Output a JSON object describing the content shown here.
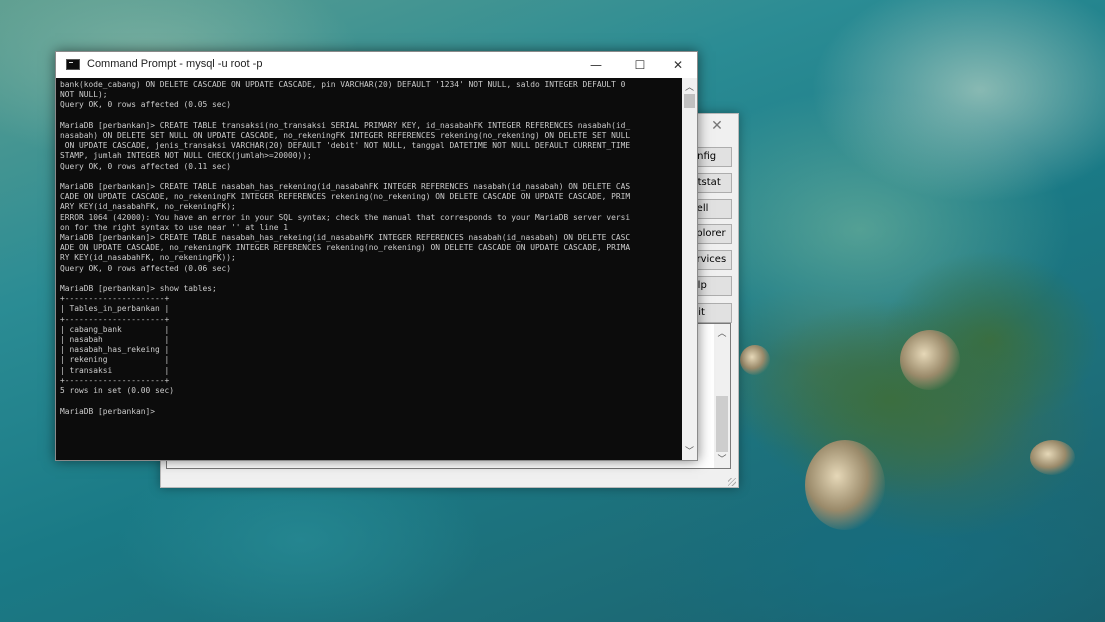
{
  "desktop": {
    "wallpaper": "satellite-coastline"
  },
  "back_window": {
    "close_symbol": "✕",
    "buttons": [
      "Config",
      "Netstat",
      "Shell",
      "Explorer",
      "Services",
      "Help",
      "Quit"
    ]
  },
  "cmd_window": {
    "title": "Command Prompt - mysql  -u root -p",
    "minimize": "—",
    "maximize": "☐",
    "close": "✕",
    "lines": [
      "bank(kode_cabang) ON DELETE CASCADE ON UPDATE CASCADE, pin VARCHAR(20) DEFAULT '1234' NOT NULL, saldo INTEGER DEFAULT 0",
      "NOT NULL);",
      "Query OK, 0 rows affected (0.05 sec)",
      "",
      "MariaDB [perbankan]> CREATE TABLE transaksi(no_transaksi SERIAL PRIMARY KEY, id_nasabahFK INTEGER REFERENCES nasabah(id_",
      "nasabah) ON DELETE SET NULL ON UPDATE CASCADE, no_rekeningFK INTEGER REFERENCES rekening(no_rekening) ON DELETE SET NULL",
      " ON UPDATE CASCADE, jenis_transaksi VARCHAR(20) DEFAULT 'debit' NOT NULL, tanggal DATETIME NOT NULL DEFAULT CURRENT_TIME",
      "STAMP, jumlah INTEGER NOT NULL CHECK(jumlah>=20000));",
      "Query OK, 0 rows affected (0.11 sec)",
      "",
      "MariaDB [perbankan]> CREATE TABLE nasabah_has_rekening(id_nasabahFK INTEGER REFERENCES nasabah(id_nasabah) ON DELETE CAS",
      "CADE ON UPDATE CASCADE, no_rekeningFK INTEGER REFERENCES rekening(no_rekening) ON DELETE CASCADE ON UPDATE CASCADE, PRIM",
      "ARY KEY(id_nasabahFK, no_rekeningFK);",
      "ERROR 1064 (42000): You have an error in your SQL syntax; check the manual that corresponds to your MariaDB server versi",
      "on for the right syntax to use near '' at line 1",
      "MariaDB [perbankan]> CREATE TABLE nasabah_has_rekeing(id_nasabahFK INTEGER REFERENCES nasabah(id_nasabah) ON DELETE CASC",
      "ADE ON UPDATE CASCADE, no_rekeningFK INTEGER REFERENCES rekening(no_rekening) ON DELETE CASCADE ON UPDATE CASCADE, PRIMA",
      "RY KEY(id_nasabahFK, no_rekeningFK));",
      "Query OK, 0 rows affected (0.06 sec)",
      "",
      "MariaDB [perbankan]> show tables;",
      "+---------------------+",
      "| Tables_in_perbankan |",
      "+---------------------+",
      "| cabang_bank         |",
      "| nasabah             |",
      "| nasabah_has_rekeing |",
      "| rekening            |",
      "| transaksi           |",
      "+---------------------+",
      "5 rows in set (0.00 sec)",
      "",
      "MariaDB [perbankan]>"
    ]
  }
}
